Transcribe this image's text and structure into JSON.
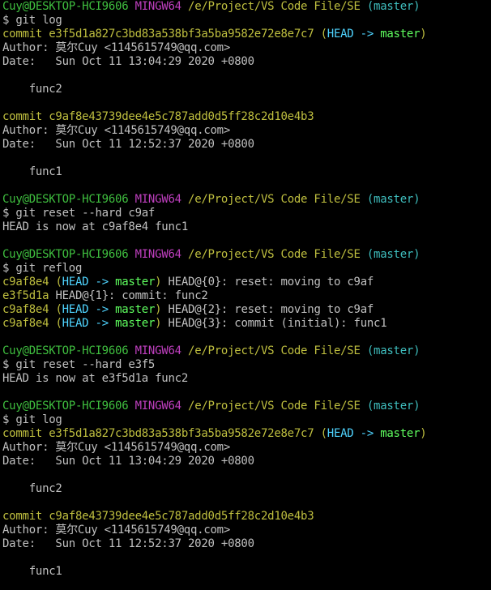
{
  "colors": {
    "background": "#000000",
    "default": "#c0c0c0",
    "green": "#3fbf3f",
    "magenta": "#bf3fbf",
    "yellow": "#bfbf3f",
    "cyan": "#3fbfbf",
    "bright_cyan": "#4fd4ff",
    "bright_green": "#5fff5f"
  },
  "terminal": {
    "lines": [
      [
        {
          "t": "Cuy@DESKTOP-HCI9606 ",
          "c": "green"
        },
        {
          "t": "MINGW64 ",
          "c": "magenta"
        },
        {
          "t": "/e/Project/VS Code File/SE ",
          "c": "yellow"
        },
        {
          "t": "(master)",
          "c": "cyan"
        }
      ],
      [
        {
          "t": "$ git log",
          "c": "default"
        }
      ],
      [
        {
          "t": "commit e3f5d1a827c3bd83a538bf3a5ba9582e72e8e7c7 ",
          "c": "yellow"
        },
        {
          "t": "(",
          "c": "yellow"
        },
        {
          "t": "HEAD -> ",
          "c": "bright_cyan"
        },
        {
          "t": "master",
          "c": "bright_green"
        },
        {
          "t": ")",
          "c": "yellow"
        }
      ],
      [
        {
          "t": "Author: 莫尔Cuy <1145615749@qq.com>",
          "c": "default"
        }
      ],
      [
        {
          "t": "Date:   Sun Oct 11 13:04:29 2020 +0800",
          "c": "default"
        }
      ],
      [],
      [
        {
          "t": "    func2",
          "c": "default"
        }
      ],
      [],
      [
        {
          "t": "commit c9af8e43739dee4e5c787add0d5ff28c2d10e4b3",
          "c": "yellow"
        }
      ],
      [
        {
          "t": "Author: 莫尔Cuy <1145615749@qq.com>",
          "c": "default"
        }
      ],
      [
        {
          "t": "Date:   Sun Oct 11 12:52:37 2020 +0800",
          "c": "default"
        }
      ],
      [],
      [
        {
          "t": "    func1",
          "c": "default"
        }
      ],
      [],
      [
        {
          "t": "Cuy@DESKTOP-HCI9606 ",
          "c": "green"
        },
        {
          "t": "MINGW64 ",
          "c": "magenta"
        },
        {
          "t": "/e/Project/VS Code File/SE ",
          "c": "yellow"
        },
        {
          "t": "(master)",
          "c": "cyan"
        }
      ],
      [
        {
          "t": "$ git reset --hard c9af",
          "c": "default"
        }
      ],
      [
        {
          "t": "HEAD is now at c9af8e4 func1",
          "c": "default"
        }
      ],
      [],
      [
        {
          "t": "Cuy@DESKTOP-HCI9606 ",
          "c": "green"
        },
        {
          "t": "MINGW64 ",
          "c": "magenta"
        },
        {
          "t": "/e/Project/VS Code File/SE ",
          "c": "yellow"
        },
        {
          "t": "(master)",
          "c": "cyan"
        }
      ],
      [
        {
          "t": "$ git reflog",
          "c": "default"
        }
      ],
      [
        {
          "t": "c9af8e4 ",
          "c": "yellow"
        },
        {
          "t": "(",
          "c": "yellow"
        },
        {
          "t": "HEAD -> ",
          "c": "bright_cyan"
        },
        {
          "t": "master",
          "c": "bright_green"
        },
        {
          "t": ")",
          "c": "yellow"
        },
        {
          "t": " HEAD@{0}: reset: moving to c9af",
          "c": "default"
        }
      ],
      [
        {
          "t": "e3f5d1a ",
          "c": "yellow"
        },
        {
          "t": "HEAD@{1}: commit: func2",
          "c": "default"
        }
      ],
      [
        {
          "t": "c9af8e4 ",
          "c": "yellow"
        },
        {
          "t": "(",
          "c": "yellow"
        },
        {
          "t": "HEAD -> ",
          "c": "bright_cyan"
        },
        {
          "t": "master",
          "c": "bright_green"
        },
        {
          "t": ")",
          "c": "yellow"
        },
        {
          "t": " HEAD@{2}: reset: moving to c9af",
          "c": "default"
        }
      ],
      [
        {
          "t": "c9af8e4 ",
          "c": "yellow"
        },
        {
          "t": "(",
          "c": "yellow"
        },
        {
          "t": "HEAD -> ",
          "c": "bright_cyan"
        },
        {
          "t": "master",
          "c": "bright_green"
        },
        {
          "t": ")",
          "c": "yellow"
        },
        {
          "t": " HEAD@{3}: commit (initial): func1",
          "c": "default"
        }
      ],
      [],
      [
        {
          "t": "Cuy@DESKTOP-HCI9606 ",
          "c": "green"
        },
        {
          "t": "MINGW64 ",
          "c": "magenta"
        },
        {
          "t": "/e/Project/VS Code File/SE ",
          "c": "yellow"
        },
        {
          "t": "(master)",
          "c": "cyan"
        }
      ],
      [
        {
          "t": "$ git reset --hard e3f5",
          "c": "default"
        }
      ],
      [
        {
          "t": "HEAD is now at e3f5d1a func2",
          "c": "default"
        }
      ],
      [],
      [
        {
          "t": "Cuy@DESKTOP-HCI9606 ",
          "c": "green"
        },
        {
          "t": "MINGW64 ",
          "c": "magenta"
        },
        {
          "t": "/e/Project/VS Code File/SE ",
          "c": "yellow"
        },
        {
          "t": "(master)",
          "c": "cyan"
        }
      ],
      [
        {
          "t": "$ git log",
          "c": "default"
        }
      ],
      [
        {
          "t": "commit e3f5d1a827c3bd83a538bf3a5ba9582e72e8e7c7 ",
          "c": "yellow"
        },
        {
          "t": "(",
          "c": "yellow"
        },
        {
          "t": "HEAD -> ",
          "c": "bright_cyan"
        },
        {
          "t": "master",
          "c": "bright_green"
        },
        {
          "t": ")",
          "c": "yellow"
        }
      ],
      [
        {
          "t": "Author: 莫尔Cuy <1145615749@qq.com>",
          "c": "default"
        }
      ],
      [
        {
          "t": "Date:   Sun Oct 11 13:04:29 2020 +0800",
          "c": "default"
        }
      ],
      [],
      [
        {
          "t": "    func2",
          "c": "default"
        }
      ],
      [],
      [
        {
          "t": "commit c9af8e43739dee4e5c787add0d5ff28c2d10e4b3",
          "c": "yellow"
        }
      ],
      [
        {
          "t": "Author: 莫尔Cuy <1145615749@qq.com>",
          "c": "default"
        }
      ],
      [
        {
          "t": "Date:   Sun Oct 11 12:52:37 2020 +0800",
          "c": "default"
        }
      ],
      [],
      [
        {
          "t": "    func1",
          "c": "default"
        }
      ],
      []
    ]
  }
}
